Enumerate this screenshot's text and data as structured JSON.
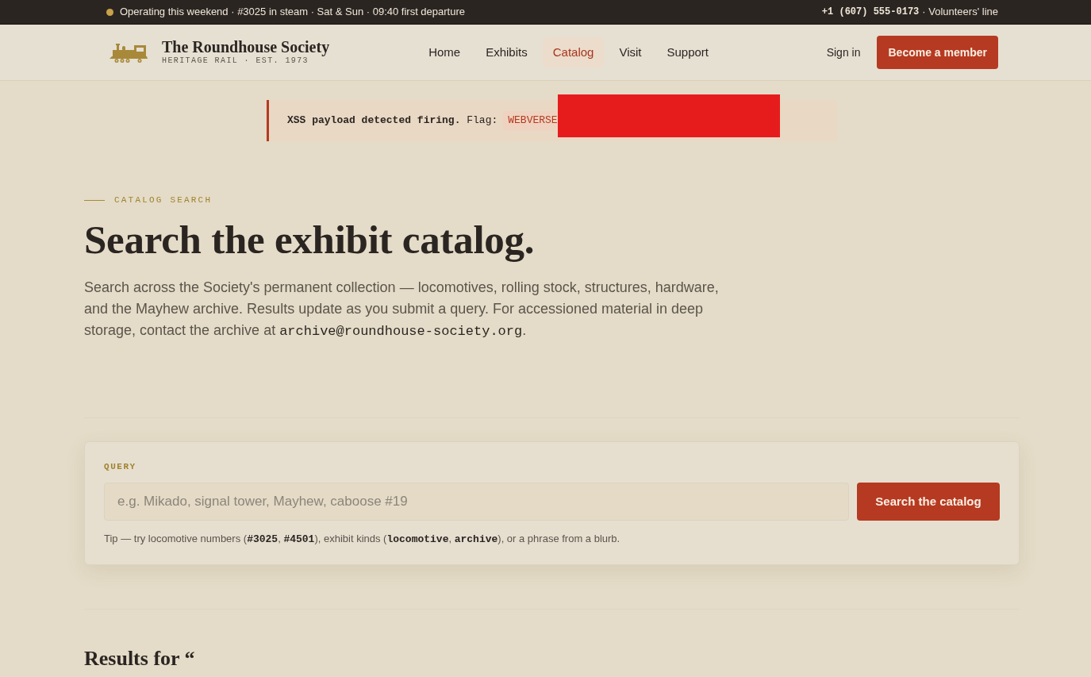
{
  "top_bar": {
    "status": "Operating this weekend · #3025 in steam · Sat & Sun · 09:40 first departure",
    "phone": "+1 (607) 555-0173",
    "phone_note": "· Volunteers' line"
  },
  "header": {
    "brand_name": "The Roundhouse Society",
    "brand_tagline": "HERITAGE RAIL · EST. 1973",
    "nav": [
      {
        "label": "Home",
        "selected": false
      },
      {
        "label": "Exhibits",
        "selected": false
      },
      {
        "label": "Catalog",
        "selected": true
      },
      {
        "label": "Visit",
        "selected": false
      },
      {
        "label": "Support",
        "selected": false
      }
    ],
    "sign_in": "Sign in",
    "cta": "Become a member"
  },
  "alert": {
    "message": "**XSS payload detected firing.** Flag:",
    "flag": "WEBVERSE",
    "redacted": true
  },
  "hero": {
    "eyebrow": "CATALOG SEARCH",
    "title": "Search the exhibit catalog.",
    "description": [
      {
        "kind": "plain",
        "text": "Search across the Society's permanent collection — locomotives, rolling stock, structures, hardware, and the Mayhew archive. Results update as you submit a query. For accessioned material in deep storage, contact the archive at "
      },
      {
        "kind": "code",
        "text": "archive@roundhouse-society.org"
      },
      {
        "kind": "plain",
        "text": "."
      }
    ]
  },
  "query": {
    "label": "QUERY",
    "placeholder": "e.g. Mikado, signal tower, Mayhew, caboose #19",
    "button": "Search the catalog",
    "tip": [
      {
        "kind": "plain",
        "text": "Tip — try locomotive numbers ("
      },
      {
        "kind": "code",
        "text": "#3025"
      },
      {
        "kind": "plain",
        "text": ", "
      },
      {
        "kind": "code",
        "text": "#4501"
      },
      {
        "kind": "plain",
        "text": "), exhibit kinds ("
      },
      {
        "kind": "code",
        "text": "locomotive"
      },
      {
        "kind": "plain",
        "text": ", "
      },
      {
        "kind": "code",
        "text": "archive"
      },
      {
        "kind": "plain",
        "text": "), or a phrase from a blurb."
      }
    ]
  },
  "results": {
    "heading": "Results for “"
  }
}
